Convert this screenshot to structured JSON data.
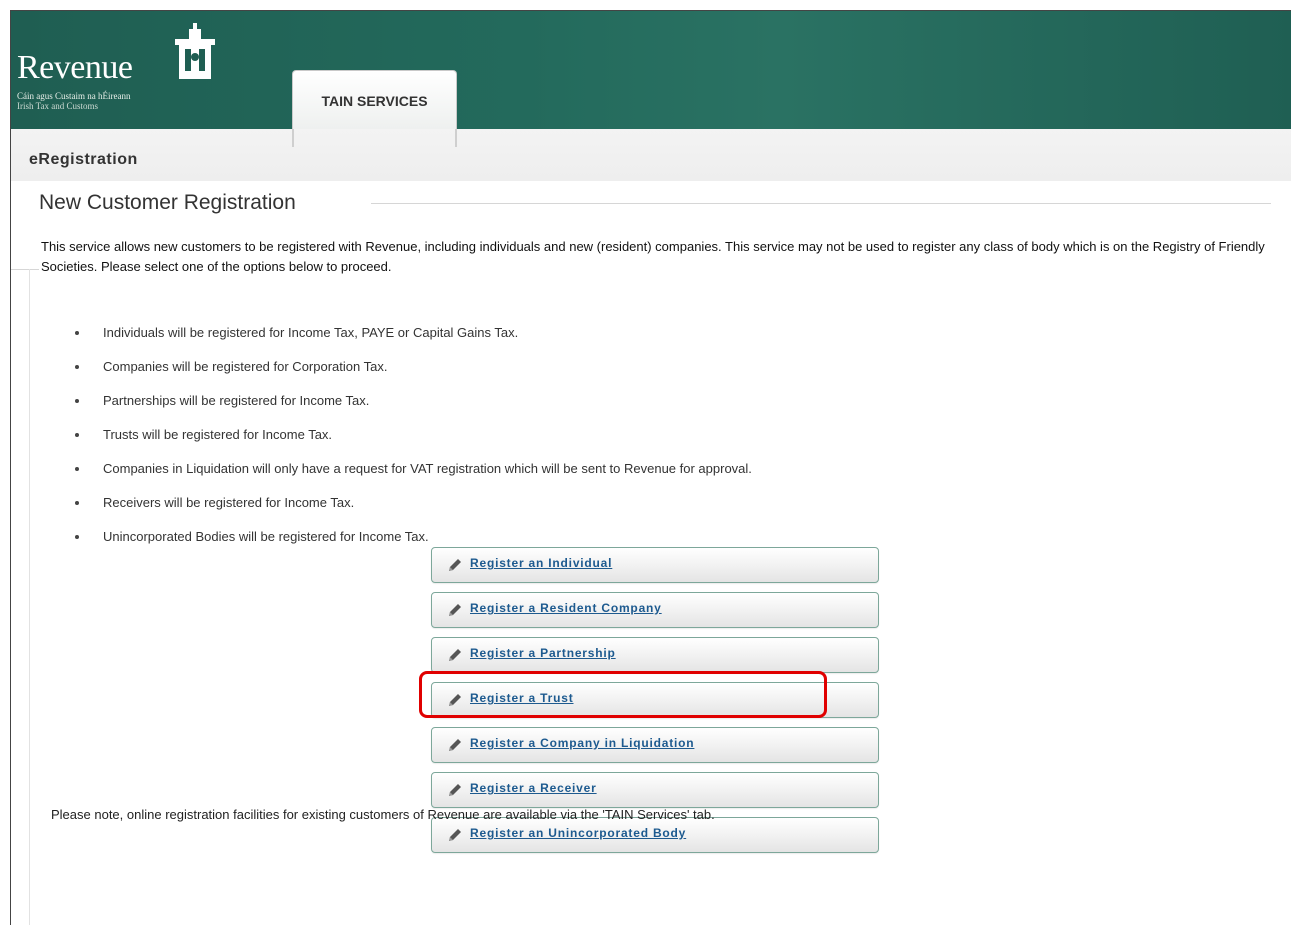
{
  "header": {
    "logo": {
      "word": "Revenue",
      "subtitle_irish": "Cáin agus Custaim na hÉireann",
      "subtitle_english": "Irish Tax and Customs"
    },
    "tab_label": "TAIN SERVICES",
    "colors": {
      "header_bg": "#1f5e52",
      "tab_bg": "#ffffff"
    }
  },
  "page": {
    "section_title": "eRegistration",
    "heading": "New Customer Registration",
    "intro": "This service allows new customers to be registered with Revenue, including individuals and new (resident) companies. This service may not be used to register any class of body which is on the Registry of Friendly Societies. Please select one of the options below to proceed.",
    "bullets": [
      "Individuals will be registered for Income Tax, PAYE or Capital Gains Tax.",
      "Companies will be registered for Corporation Tax.",
      "Partnerships will be registered for Income Tax.",
      "Trusts will be registered for Income Tax.",
      "Companies in Liquidation will only have a request for VAT registration which will be sent to Revenue for approval.",
      "Receivers will be registered for Income Tax.",
      "Unincorporated Bodies will be registered for Income Tax."
    ],
    "buttons": [
      {
        "label": "Register an Individual",
        "icon": "pencil-icon"
      },
      {
        "label": "Register a Resident Company",
        "icon": "pencil-icon"
      },
      {
        "label": "Register a Partnership",
        "icon": "pencil-icon"
      },
      {
        "label": "Register a Trust",
        "icon": "pencil-icon",
        "highlighted": true
      },
      {
        "label": "Register a Company in Liquidation",
        "icon": "pencil-icon"
      },
      {
        "label": "Register a Receiver",
        "icon": "pencil-icon"
      },
      {
        "label": "Register an Unincorporated Body",
        "icon": "pencil-icon"
      }
    ],
    "note": "Please note, online registration facilities for existing customers of Revenue are available via the 'TAIN Services' tab.",
    "colors": {
      "link": "#1d5a8f",
      "button_border": "#7da79a",
      "highlight": "#e00000"
    }
  }
}
